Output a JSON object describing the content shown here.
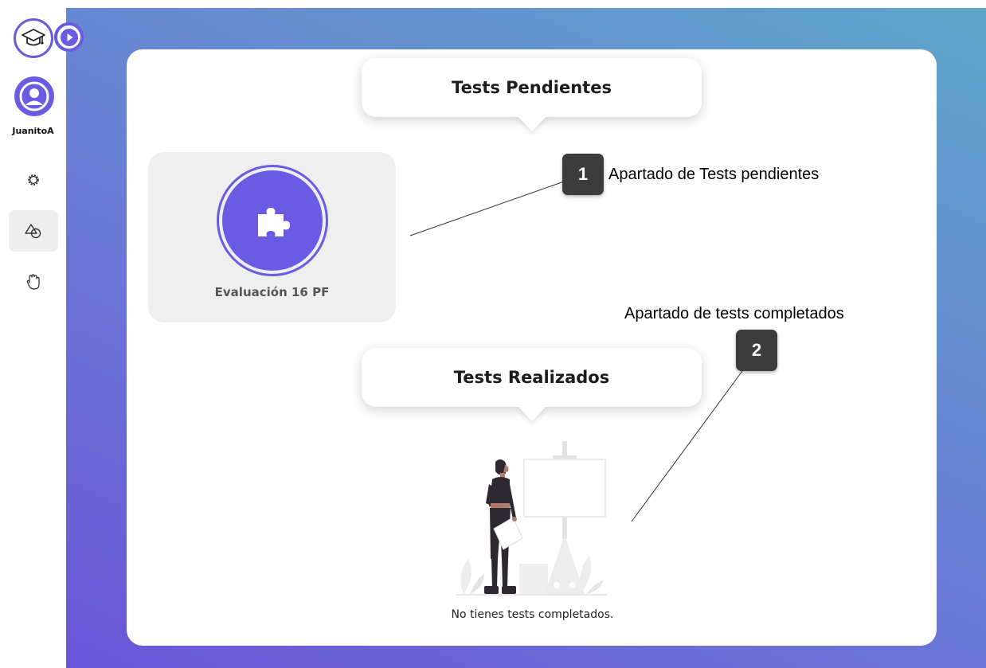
{
  "user": {
    "username": "JuanitoA"
  },
  "sections": {
    "pending": {
      "title": "Tests Pendientes"
    },
    "done": {
      "title": "Tests Realizados",
      "empty_message": "No tienes tests completados."
    }
  },
  "tests": [
    {
      "title": "Evaluación 16 PF",
      "icon": "puzzle-icon"
    }
  ],
  "annotations": [
    {
      "number": "1",
      "text": "Apartado de Tests pendientes"
    },
    {
      "number": "2",
      "text": "Apartado de tests completados"
    }
  ],
  "icons": {
    "logo": "graduation-cap-icon",
    "expand": "chevron-right-icon",
    "avatar": "user-icon",
    "nav": [
      "gear-icon",
      "shapes-icon",
      "hand-icon"
    ]
  },
  "colors": {
    "accent": "#6a5be2",
    "badge": "#3c3c3c",
    "gradient_start": "#6a55d8",
    "gradient_end": "#5fa6ca"
  }
}
